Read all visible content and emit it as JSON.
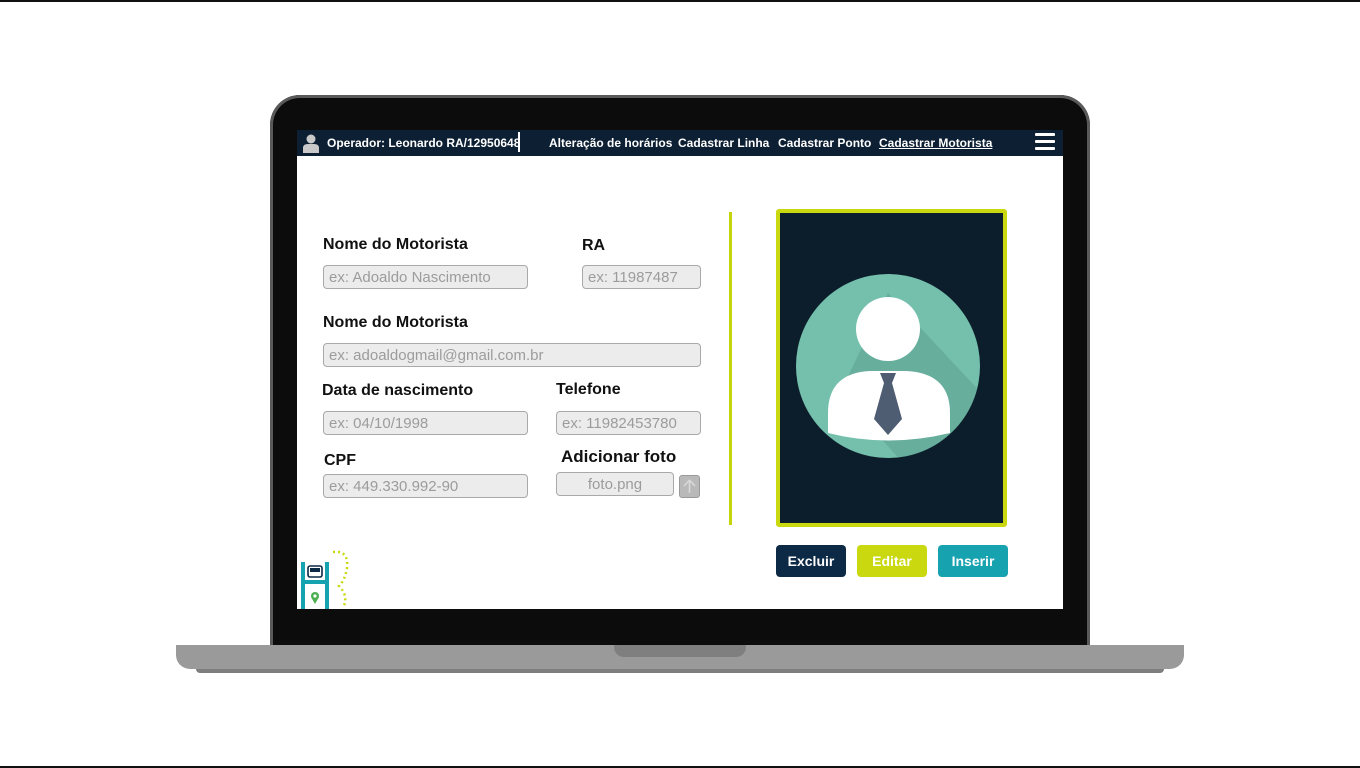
{
  "navbar": {
    "operator_label": "Operador: Leonardo RA/12950648",
    "links": [
      {
        "label": "Alteração de horários"
      },
      {
        "label": "Cadastrar Linha"
      },
      {
        "label": "Cadastrar Ponto"
      },
      {
        "label": "Cadastrar Motorista",
        "active": true
      }
    ],
    "menu_icon": "hamburger-icon",
    "user_icon": "user-icon"
  },
  "form": {
    "name_label": "Nome do Motorista",
    "name_placeholder": "ex: Adoaldo Nascimento",
    "ra_label": "RA",
    "ra_placeholder": "ex: 11987487",
    "email_label": "Nome do Motorista",
    "email_placeholder": "ex: adoaldogmail@gmail.com.br",
    "birth_label": "Data de nascimento",
    "birth_placeholder": "ex: 04/10/1998",
    "phone_label": "Telefone",
    "phone_placeholder": "ex: 11982453780",
    "cpf_label": "CPF",
    "cpf_placeholder": "ex: 449.330.992-90",
    "photo_label": "Adicionar foto",
    "photo_placeholder": "foto.png",
    "upload_icon": "upload-arrow-icon"
  },
  "actions": {
    "delete_label": "Excluir",
    "edit_label": "Editar",
    "insert_label": "Inserir"
  },
  "colors": {
    "navbar_bg": "#0c1f33",
    "accent_lime": "#c9d80f",
    "button_dark": "#0c2a45",
    "button_teal": "#17a2b0",
    "avatar_circle": "#74c0ad"
  }
}
